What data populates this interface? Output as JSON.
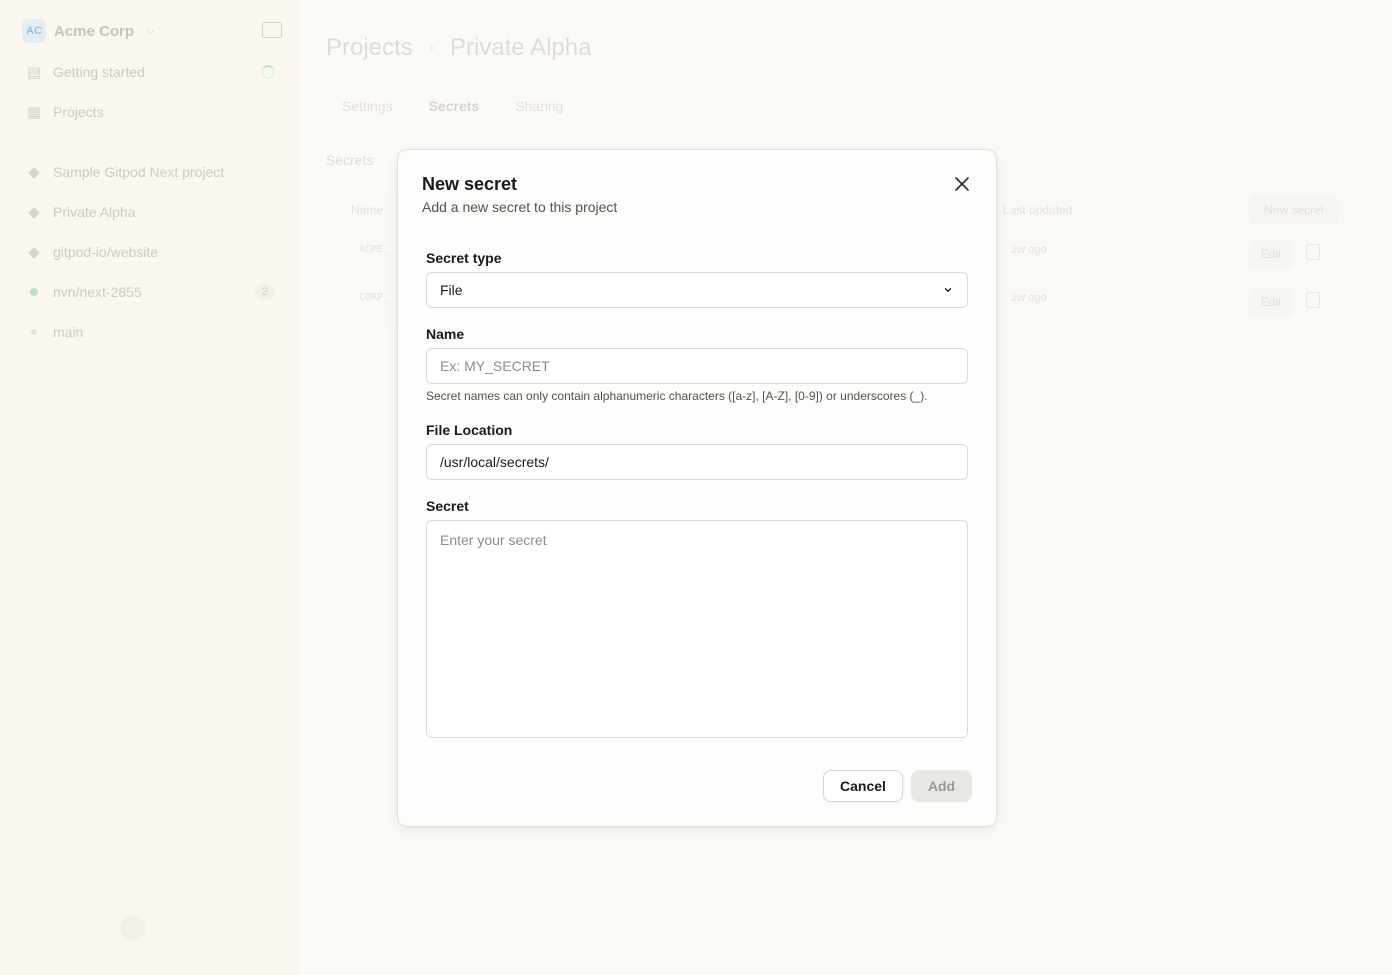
{
  "sidebar": {
    "org_initials": "AC",
    "org_name": "Acme Corp",
    "nav": [
      {
        "label": "Getting started"
      },
      {
        "label": "Projects"
      }
    ],
    "projects": [
      {
        "label": "Sample Gitpod Next project"
      },
      {
        "label": "Private Alpha"
      },
      {
        "label": "gitpod-io/website"
      }
    ],
    "environments": [
      {
        "label": "nvn/next-2855",
        "count": "2"
      },
      {
        "label": "main"
      }
    ]
  },
  "main": {
    "breadcrumb": {
      "root": "Projects",
      "current": "Private Alpha"
    },
    "tabs": [
      {
        "label": "Settings"
      },
      {
        "label": "Secrets"
      },
      {
        "label": "Sharing"
      }
    ],
    "section_title": "Secrets",
    "table": {
      "headers": {
        "name": "Name",
        "last_updated": "Last updated"
      },
      "new_secret_label": "New secret",
      "rows": [
        {
          "name": "ACME_",
          "updated": "2w ago",
          "edit": "Edit"
        },
        {
          "name": "CORP_",
          "updated": "2w ago",
          "edit": "Edit"
        }
      ]
    }
  },
  "modal": {
    "title": "New secret",
    "subtitle": "Add a new secret to this project",
    "secret_type": {
      "label": "Secret type",
      "value": "File"
    },
    "name": {
      "label": "Name",
      "placeholder": "Ex: MY_SECRET",
      "hint": "Secret names can only contain alphanumeric characters ([a-z], [A-Z], [0-9]) or underscores (_)."
    },
    "file_location": {
      "label": "File Location",
      "value": "/usr/local/secrets/"
    },
    "secret": {
      "label": "Secret",
      "placeholder": "Enter your secret"
    },
    "cancel_label": "Cancel",
    "add_label": "Add"
  }
}
